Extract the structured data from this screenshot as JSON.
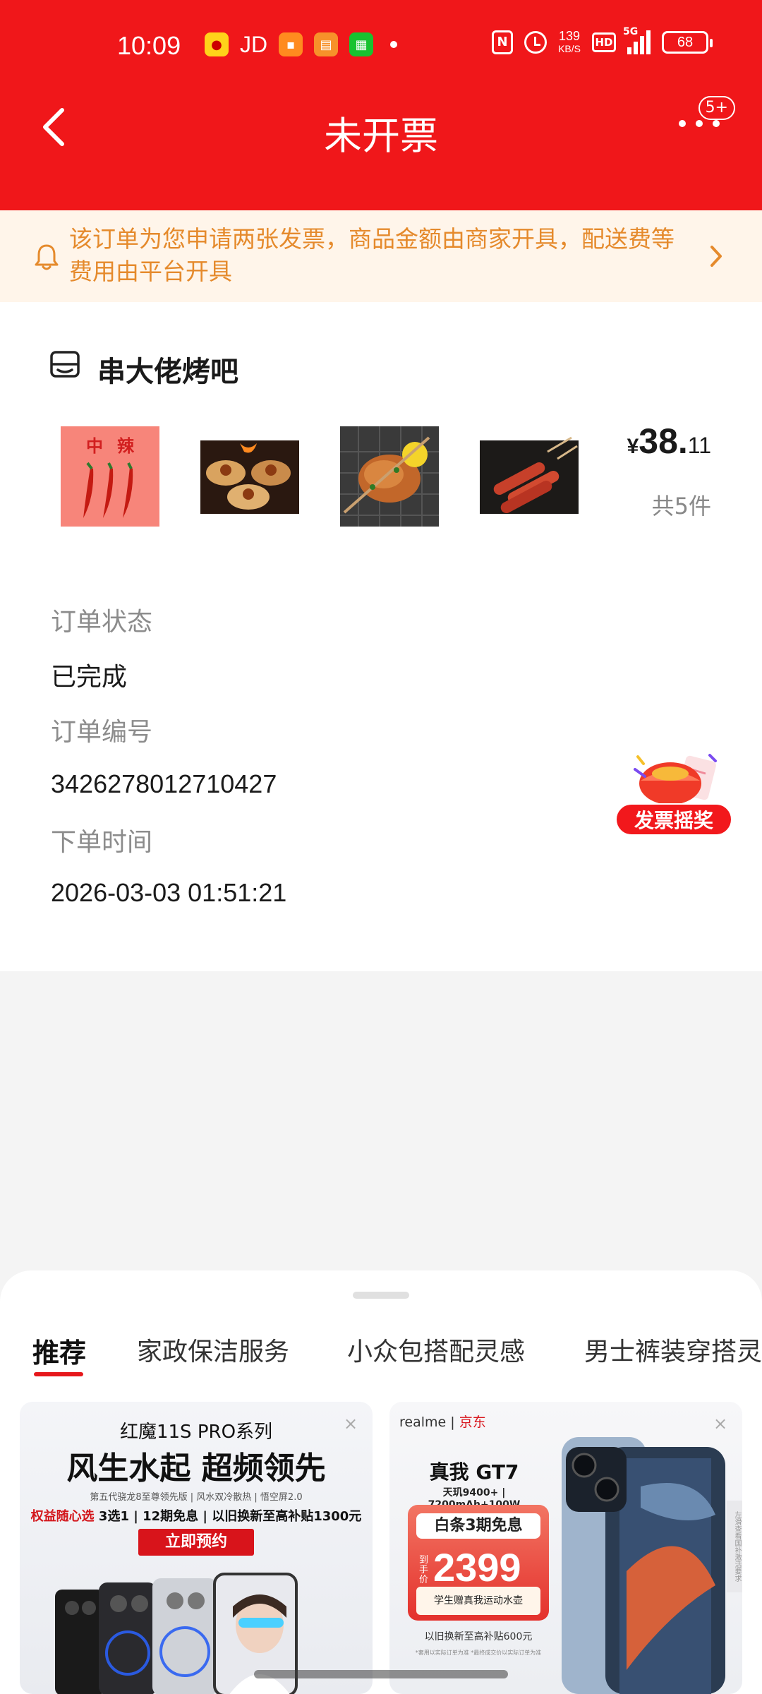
{
  "status_bar": {
    "time": "10:09",
    "jd_label": "JD",
    "net_speed_value": "139",
    "net_speed_unit": "KB/S",
    "hd_label": "HD",
    "network_label": "5G",
    "battery": "68"
  },
  "header": {
    "title": "未开票",
    "more_badge": "5+"
  },
  "notice": {
    "text": "该订单为您申请两张发票，商品金额由商家开具，配送费等费用由平台开具"
  },
  "order": {
    "shop_name": "串大佬烤吧",
    "thumbnails": [
      "中辣辣椒",
      "烤扇贝",
      "烤鸡翅",
      "烤肠"
    ],
    "thumb_text_1": "中",
    "thumb_text_2": "辣",
    "price_currency": "¥",
    "price_int": "38.",
    "price_dec": "11",
    "item_count": "共5件",
    "status_label": "订单状态",
    "status_value": "已完成",
    "number_label": "订单编号",
    "number_value": "3426278012710427",
    "time_label": "下单时间",
    "time_value": "2026-03-03 01:51:21",
    "lottery_label": "发票摇奖"
  },
  "recommend": {
    "tabs": [
      "推荐",
      "家政保洁服务",
      "小众包搭配灵感",
      "男士裤装穿搭灵"
    ],
    "active_tab": 0
  },
  "ads": [
    {
      "series": "红魔11S PRO系列",
      "headline": "风生水起 超频领先",
      "spec": "第五代骁龙8至尊领先版 | 风水双冷散热 | 悟空屏2.0",
      "offer_brand": "权益随心选",
      "offer_rest": " 3选1 | 12期免息 | 以旧换新至高补贴1300元",
      "cta": "立即预约",
      "close": "×"
    },
    {
      "brand": "realme",
      "partner": "京东",
      "model": "真我 GT7",
      "spec": "天玑9400+ | 7200mAh+100W",
      "badge": "白条3期免息",
      "price_label": "到手价",
      "price": "2399",
      "gift": "学生赠真我运动水壶",
      "tradein": "以旧换新至高补贴600元",
      "fine_print": "*套用以实际订单为准 *最终成交价以实际订单为准",
      "side_tab": "左滑查看国补激活要求",
      "close": "×"
    }
  ],
  "colors": {
    "brand_red": "#f0171a",
    "notice_bg": "#fff5ea",
    "notice_text": "#e58a2c",
    "label_gray": "#8c8c8c"
  }
}
